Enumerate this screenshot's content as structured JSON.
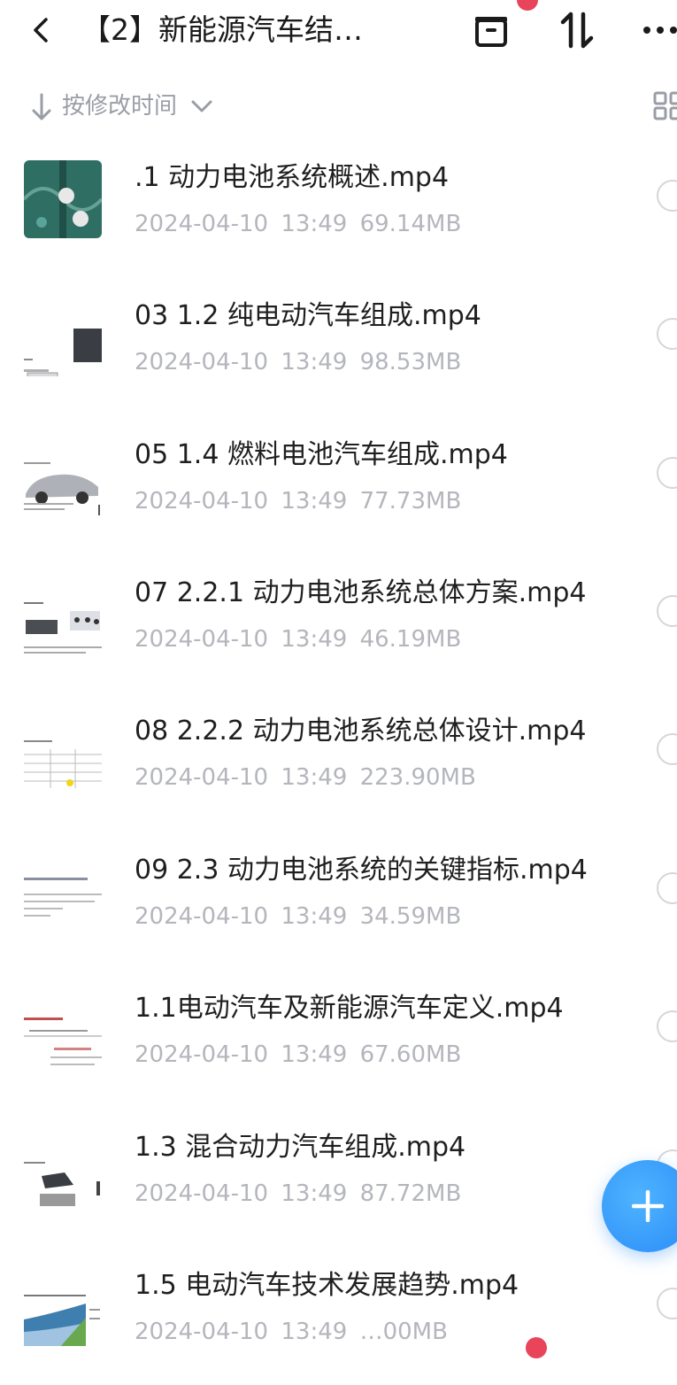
{
  "header": {
    "title": "【2】新能源汽车结…"
  },
  "sort": {
    "label": "按修改时间"
  },
  "files": [
    {
      "name": ".1 动力电池系统概述.mp4",
      "date": "2024-04-10",
      "time": "13:49",
      "size": "69.14MB"
    },
    {
      "name": "03 1.2 纯电动汽车组成.mp4",
      "date": "2024-04-10",
      "time": "13:49",
      "size": "98.53MB"
    },
    {
      "name": "05 1.4 燃料电池汽车组成.mp4",
      "date": "2024-04-10",
      "time": "13:49",
      "size": "77.73MB"
    },
    {
      "name": "07 2.2.1 动力电池系统总体方案.mp4",
      "date": "2024-04-10",
      "time": "13:49",
      "size": "46.19MB"
    },
    {
      "name": "08 2.2.2 动力电池系统总体设计.mp4",
      "date": "2024-04-10",
      "time": "13:49",
      "size": "223.90MB"
    },
    {
      "name": "09 2.3 动力电池系统的关键指标.mp4",
      "date": "2024-04-10",
      "time": "13:49",
      "size": "34.59MB"
    },
    {
      "name": "1.1电动汽车及新能源汽车定义.mp4",
      "date": "2024-04-10",
      "time": "13:49",
      "size": "67.60MB"
    },
    {
      "name": "1.3 混合动力汽车组成.mp4",
      "date": "2024-04-10",
      "time": "13:49",
      "size": "87.72MB"
    },
    {
      "name": "1.5 电动汽车技术发展趋势.mp4",
      "date": "2024-04-10",
      "time": "13:49",
      "size": "…00MB"
    }
  ],
  "colors": {
    "accent": "#2a8cf7",
    "meta_text": "#b4b6bc",
    "badge": "#e8445a"
  },
  "icons": [
    "back-arrow-icon",
    "archive-icon",
    "sort-swap-icon",
    "more-icon",
    "sort-down-arrow-icon",
    "chevron-down-icon",
    "grid-view-icon",
    "plus-icon"
  ]
}
